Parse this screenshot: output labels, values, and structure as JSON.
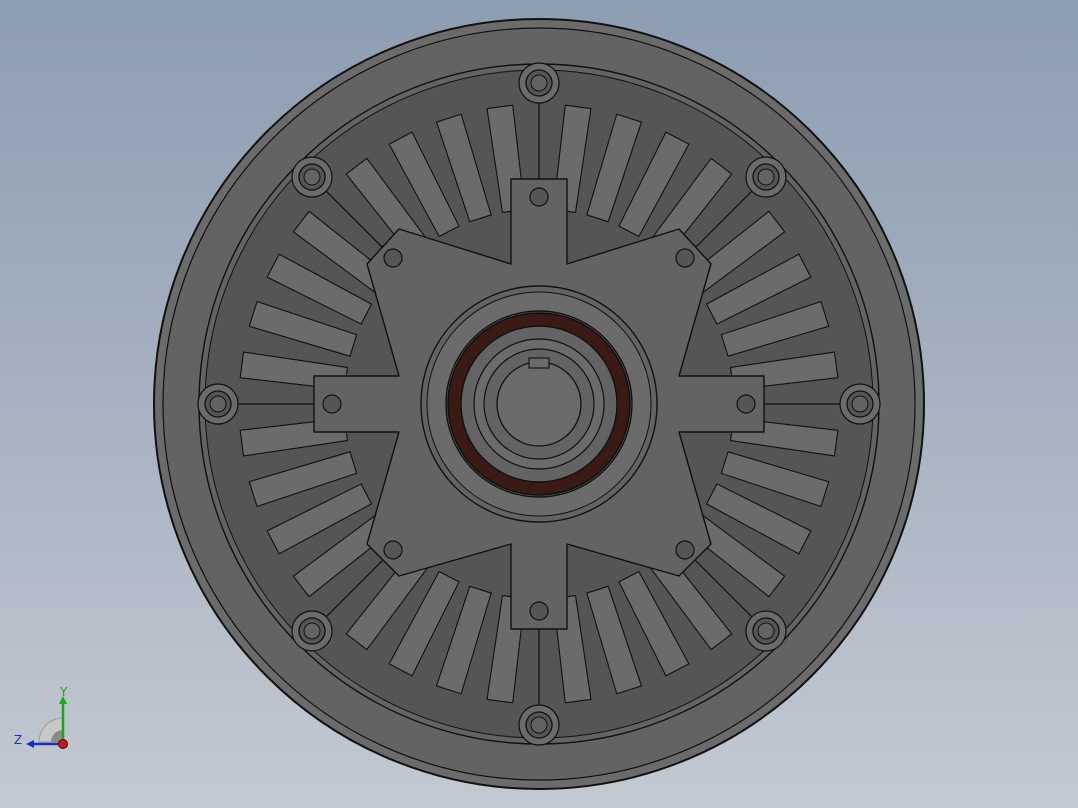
{
  "viewport": {
    "background_top": "#8d9db2",
    "background_bottom": "#c3c9d1"
  },
  "model": {
    "part_color": "#636363",
    "edge_color": "#111111",
    "bearing_ring_color": "#3a1a14",
    "bolt_holes_outer": 8,
    "cooling_fin_groups": 8
  },
  "triad": {
    "y_label": "Y",
    "z_label": "Z",
    "y_color": "#1aa51a",
    "z_color": "#1a2fbf",
    "x_color": "#c21a1a"
  }
}
